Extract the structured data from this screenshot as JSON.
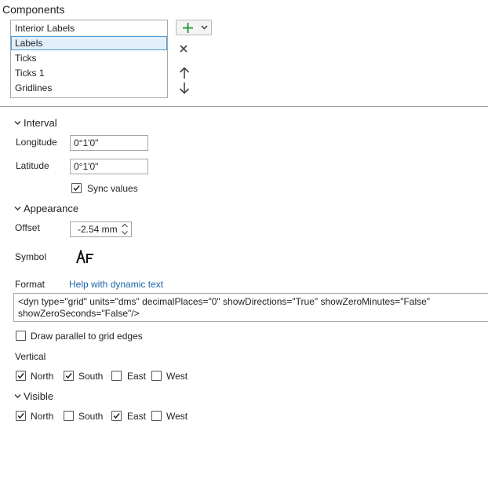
{
  "components": {
    "title": "Components",
    "items": [
      "Interior Labels",
      "Labels",
      "Ticks",
      "Ticks 1",
      "Gridlines"
    ],
    "selected": "Labels"
  },
  "interval": {
    "title": "Interval",
    "longitude_label": "Longitude",
    "longitude_value": "0°1'0\"",
    "latitude_label": "Latitude",
    "latitude_value": "0°1'0\"",
    "sync_label": "Sync values",
    "sync_checked": true
  },
  "appearance": {
    "title": "Appearance",
    "offset_label": "Offset",
    "offset_value": "-2.54 mm",
    "symbol_label": "Symbol",
    "format_label": "Format",
    "help_link": "Help with dynamic text",
    "format_text": "<dyn type=\"grid\" units=\"dms\" decimalPlaces=\"0\" showDirections=\"True\" showZeroMinutes=\"False\" showZeroSeconds=\"False\"/>",
    "draw_parallel_label": "Draw parallel to grid edges",
    "draw_parallel_checked": false,
    "vertical_label": "Vertical",
    "vertical": {
      "north": {
        "label": "North",
        "checked": true
      },
      "south": {
        "label": "South",
        "checked": true
      },
      "east": {
        "label": "East",
        "checked": false
      },
      "west": {
        "label": "West",
        "checked": false
      }
    }
  },
  "visible": {
    "title": "Visible",
    "north": {
      "label": "North",
      "checked": true
    },
    "south": {
      "label": "South",
      "checked": false
    },
    "east": {
      "label": "East",
      "checked": true
    },
    "west": {
      "label": "West",
      "checked": false
    }
  },
  "colors": {
    "accent_green": "#2e9e3f",
    "link_blue": "#1a66a8",
    "selection": "#e1effa"
  }
}
